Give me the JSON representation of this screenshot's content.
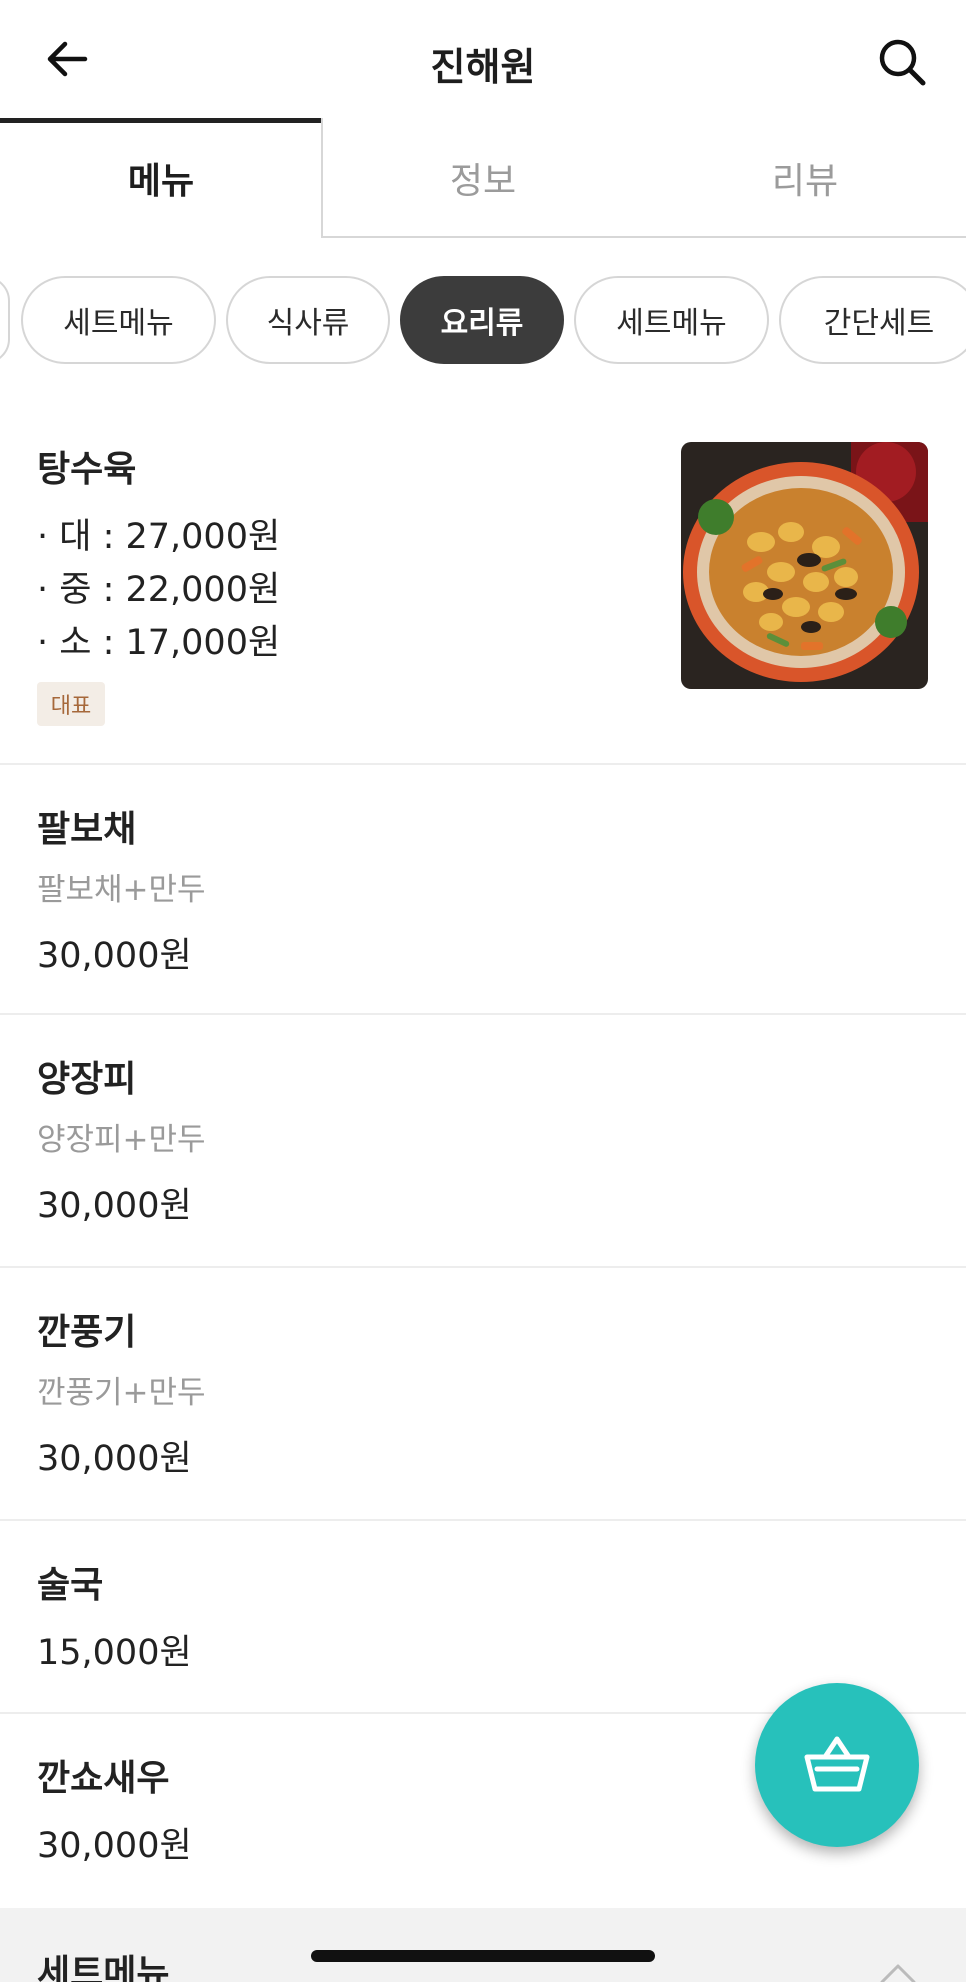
{
  "header": {
    "title": "진해원",
    "back_icon": "arrow-left-icon",
    "search_icon": "search-icon"
  },
  "tabs": [
    {
      "label": "메뉴",
      "active": true
    },
    {
      "label": "정보",
      "active": false
    },
    {
      "label": "리뷰",
      "active": false
    }
  ],
  "chips": [
    {
      "label": "세트메뉴",
      "active": false
    },
    {
      "label": "식사류",
      "active": false
    },
    {
      "label": "요리류",
      "active": true
    },
    {
      "label": "세트메뉴",
      "active": false
    },
    {
      "label": "간단세트",
      "active": false
    }
  ],
  "menu": [
    {
      "name": "탕수육",
      "prices": [
        "· 대 : 27,000원",
        "· 중 : 22,000원",
        "· 소 : 17,000원"
      ],
      "badge": "대표"
    },
    {
      "name": "팔보채",
      "desc": "팔보채+만두",
      "price": "30,000원"
    },
    {
      "name": "양장피",
      "desc": "양장피+만두",
      "price": "30,000원"
    },
    {
      "name": "깐풍기",
      "desc": "깐풍기+만두",
      "price": "30,000원"
    },
    {
      "name": "술국",
      "price": "15,000원"
    },
    {
      "name": "깐쇼새우",
      "price": "30,000원"
    }
  ],
  "cart_icon": "basket-icon",
  "section": {
    "title": "세트메뉴"
  },
  "colors": {
    "accent": "#27c1bb",
    "chip_active": "#3c3c3c",
    "badge_bg": "#f3ede6",
    "badge_text": "#a6683a"
  }
}
